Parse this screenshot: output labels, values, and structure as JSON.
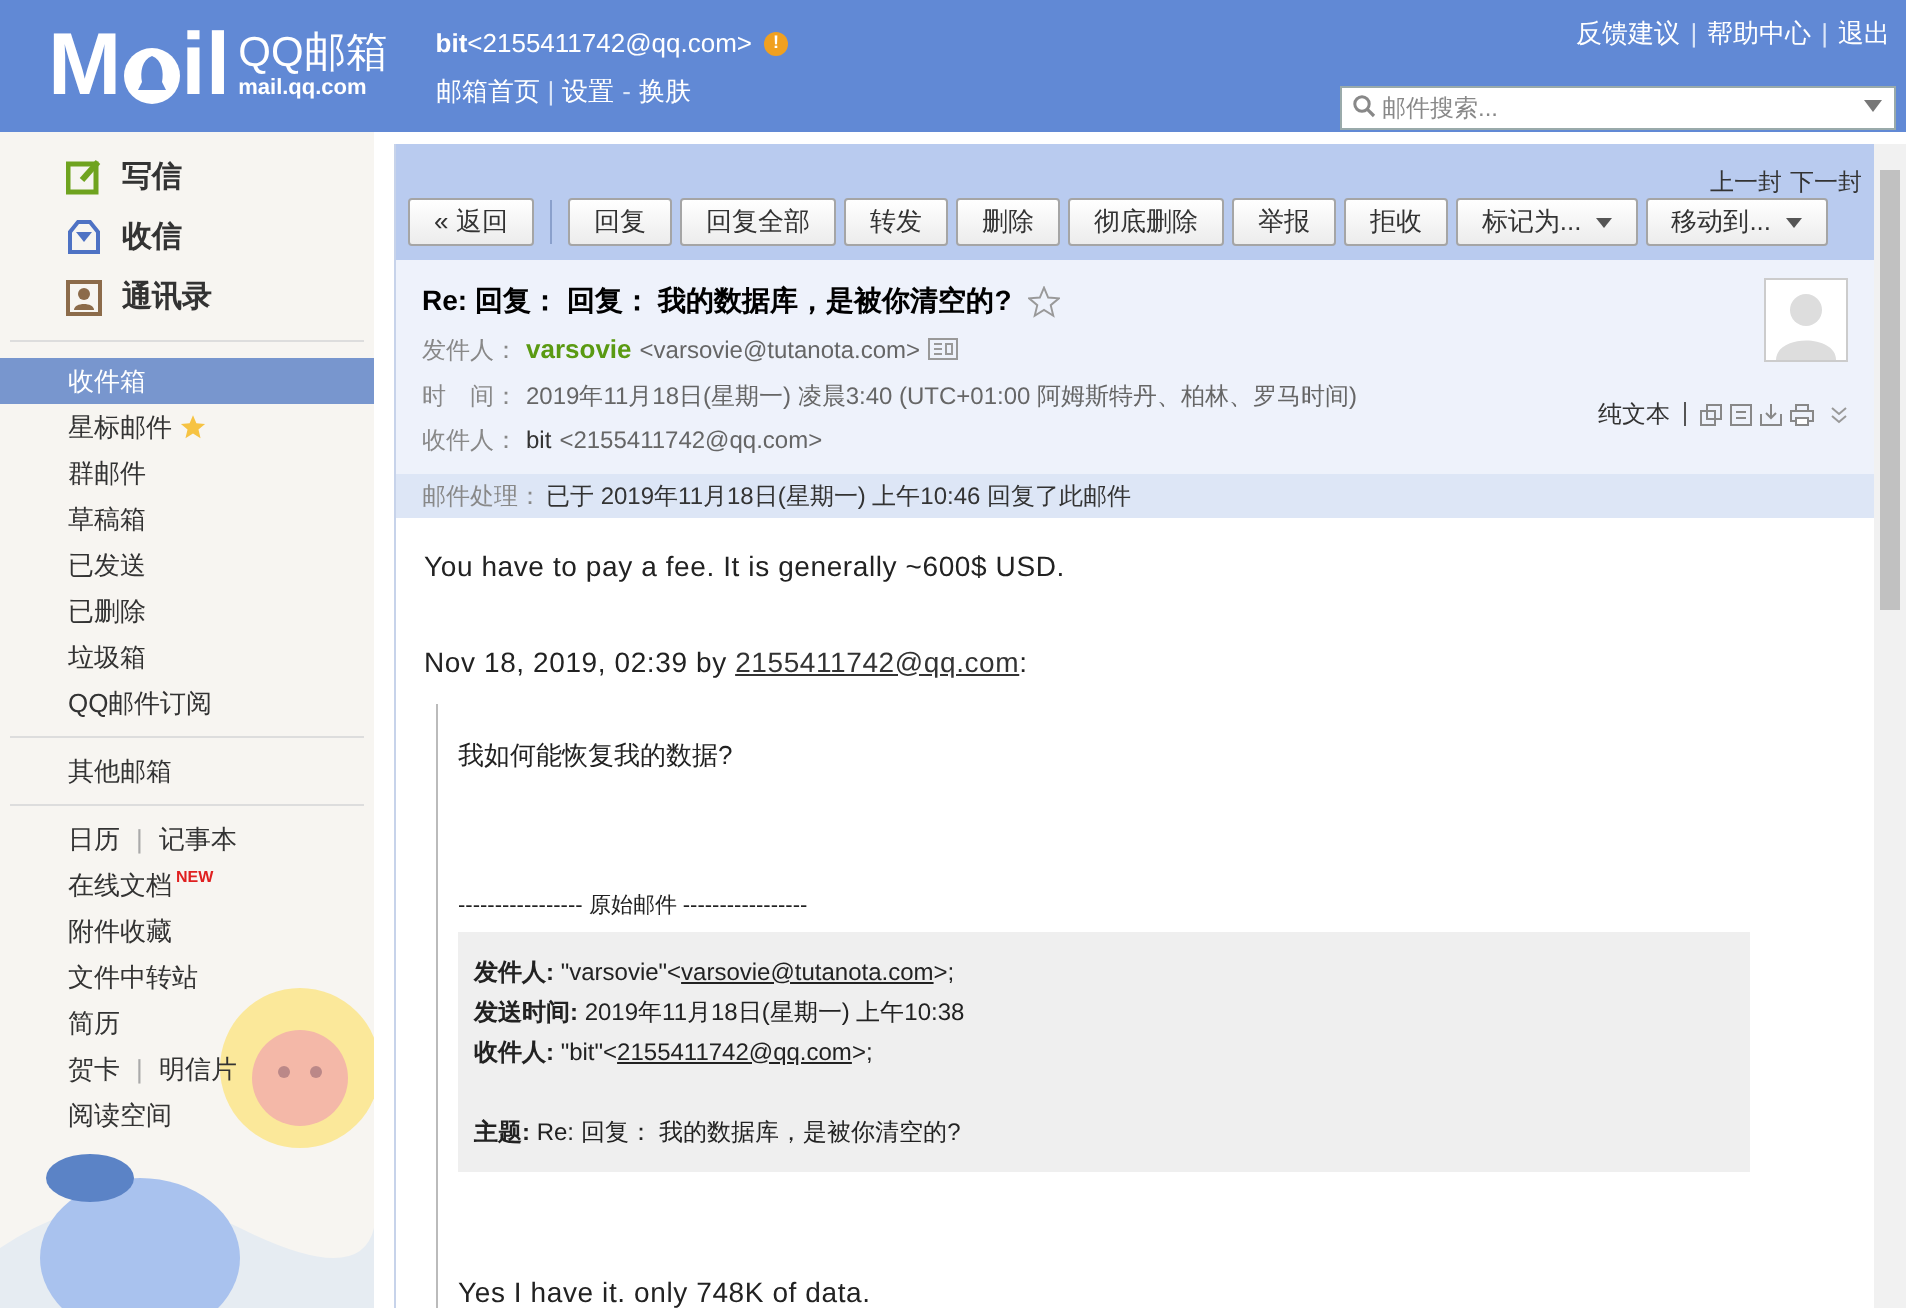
{
  "header": {
    "logo": {
      "left": "M",
      "right": "il"
    },
    "brand": "QQ邮箱",
    "domain": "mail.qq.com",
    "account": "**bit**<2155411742@qq.com>",
    "warning": "!",
    "links": [
      {
        "kind": "link",
        "text": "邮箱首页"
      },
      {
        "kind": "sep",
        "text": "|"
      },
      {
        "kind": "link",
        "text": "设置"
      },
      {
        "kind": "sep",
        "text": "-"
      },
      {
        "kind": "link",
        "text": "换肤"
      }
    ],
    "top_links": [
      {
        "kind": "link",
        "text": "反馈建议"
      },
      {
        "kind": "sep",
        "text": "|"
      },
      {
        "kind": "link",
        "text": "帮助中心"
      },
      {
        "kind": "sep",
        "text": "|"
      },
      {
        "kind": "link",
        "text": "退出"
      }
    ],
    "search": {
      "placeholder": "邮件搜索..."
    }
  },
  "sidebar": {
    "actions": [
      {
        "kind": "compose",
        "label": "写信"
      },
      {
        "kind": "inbox",
        "label": "收信"
      },
      {
        "kind": "contacts",
        "label": "通讯录"
      }
    ],
    "folders": [
      {
        "label": "收件箱",
        "selected": true,
        "starred": false
      },
      {
        "label": "星标邮件",
        "selected": false,
        "starred": true
      },
      {
        "label": "群邮件",
        "selected": false,
        "starred": false
      },
      {
        "label": "草稿箱",
        "selected": false,
        "starred": false
      },
      {
        "label": "已发送",
        "selected": false,
        "starred": false
      },
      {
        "label": "已删除",
        "selected": false,
        "starred": false
      },
      {
        "label": "垃圾箱",
        "selected": false,
        "starred": false
      },
      {
        "label": "QQ邮件订阅",
        "selected": false,
        "starred": false
      }
    ],
    "other": "其他邮箱",
    "tools": [
      {
        "items": [
          "日历",
          "记事本"
        ]
      },
      {
        "items": [
          "在线文档"
        ],
        "badge": "NEW"
      },
      {
        "items": [
          "附件收藏"
        ]
      },
      {
        "items": [
          "文件中转站"
        ]
      },
      {
        "items": [
          "简历"
        ]
      },
      {
        "items": [
          "贺卡",
          "明信片"
        ]
      },
      {
        "items": [
          "阅读空间"
        ]
      }
    ],
    "tool_separator": "|"
  },
  "toolbar": {
    "nav": [
      "上一封",
      "下一封"
    ],
    "buttons": [
      {
        "kind": "back",
        "label": "« 返回"
      },
      {
        "kind": "plain",
        "label": "回复"
      },
      {
        "kind": "plain",
        "label": "回复全部"
      },
      {
        "kind": "plain",
        "label": "转发"
      },
      {
        "kind": "plain",
        "label": "删除"
      },
      {
        "kind": "plain",
        "label": "彻底删除"
      },
      {
        "kind": "plain",
        "label": "举报"
      },
      {
        "kind": "plain",
        "label": "拒收"
      },
      {
        "kind": "dropdown",
        "label": "标记为..."
      },
      {
        "kind": "dropdown",
        "label": "移动到..."
      }
    ]
  },
  "email": {
    "subject": "Re: 回复： 回复： 我的数据库，是被你清空的?",
    "starred": false,
    "from": {
      "label": "发件人：",
      "name": "varsovie",
      "address": "<varsovie@tutanota.com>"
    },
    "time": {
      "label": "时　间：",
      "value": "2019年11月18日(星期一) 凌晨3:40 (UTC+01:00 阿姆斯特丹、柏林、罗马时间)"
    },
    "to": {
      "label": "收件人：",
      "name": "bit",
      "address": "<2155411742@qq.com>"
    },
    "plain_text": "纯文本",
    "status": {
      "label": "邮件处理：",
      "text": "已于 2019年11月18日(星期一) 上午10:46 回复了此邮件"
    },
    "body": {
      "reply": "You have to pay a fee. It is generally ~600$ USD.",
      "quote_intro": {
        "text": "Nov 18, 2019, 02:39 by ",
        "link": "2155411742@qq.com",
        "end": ":"
      },
      "question": "我如何能恢复我的数据?",
      "divider": "----------------- 原始邮件 -----------------",
      "original": [
        {
          "label": "发件人:",
          "before": " \"varsovie\"<",
          "link": "varsovie@tutanota.com",
          "after": ">;"
        },
        {
          "label": "发送时间:",
          "before": " 2019年11月18日(星期一) 上午10:38"
        },
        {
          "label": "收件人:",
          "before": " \"bit\"<",
          "link": "2155411742@qq.com",
          "after": ">;"
        },
        {
          "label": "主题:",
          "before": " Re: 回复： 我的数据库，是被你清空的?"
        }
      ],
      "answer": "Yes I have it. only 748K of data."
    }
  }
}
